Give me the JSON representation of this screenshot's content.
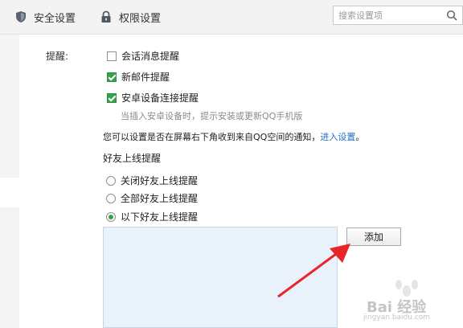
{
  "tabs": {
    "security_label": "安全设置",
    "permission_label": "权限设置"
  },
  "search": {
    "placeholder": "搜索设置项",
    "value": ""
  },
  "reminders": {
    "title": "提醒:",
    "options": [
      {
        "label": "会话消息提醒",
        "checked": false
      },
      {
        "label": "新邮件提醒",
        "checked": true
      },
      {
        "label": "安卓设备连接提醒",
        "checked": true
      }
    ],
    "android_hint": "当插入安卓设备时，提示安装或更新QQ手机版",
    "qzone_notice": "您可以设置是否在屏幕右下角收到来自QQ空间的通知，",
    "qzone_link": "进入设置",
    "qzone_tail": "。"
  },
  "friend_online": {
    "section_title": "好友上线提醒",
    "options": [
      {
        "label": "关闭好友上线提醒",
        "checked": false
      },
      {
        "label": "全部好友上线提醒",
        "checked": false
      },
      {
        "label": "以下好友上线提醒",
        "checked": true
      }
    ],
    "add_button": "添加"
  },
  "watermark": {
    "text": "Bai 经验",
    "sub": "jingyan.baidu.com"
  },
  "colors": {
    "check_green": "#35a24c",
    "link_blue": "#1e6fc8",
    "arrow_red": "#e8262a"
  },
  "icons": {
    "security": "shield-icon",
    "permission": "lock-icon",
    "search": "search-icon"
  }
}
